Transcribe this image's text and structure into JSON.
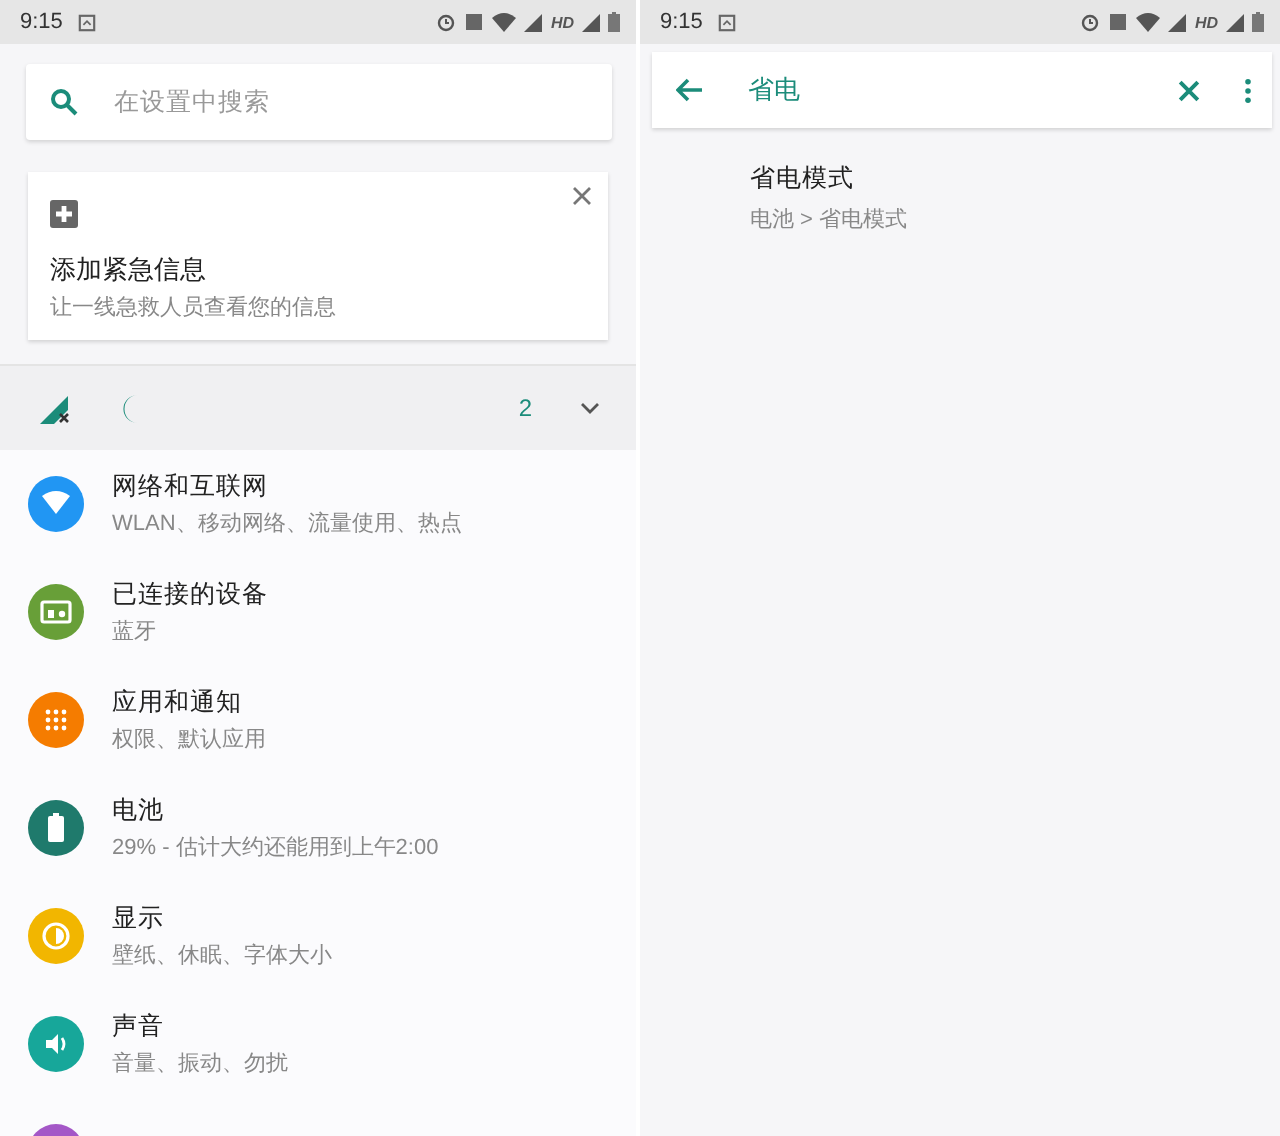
{
  "left_screen": {
    "status_bar": {
      "time": "9:15",
      "network_label": "HD"
    },
    "search": {
      "placeholder": "在设置中搜索"
    },
    "suggestion_card": {
      "title": "添加紧急信息",
      "subtitle": "让一线急救人员查看您的信息"
    },
    "conditions": {
      "count": "2",
      "expanded": false
    },
    "settings": [
      {
        "kind": "network",
        "color": "#2196f3",
        "title": "网络和互联网",
        "subtitle": "WLAN、移动网络、流量使用、热点"
      },
      {
        "kind": "devices",
        "color": "#689f38",
        "title": "已连接的设备",
        "subtitle": "蓝牙"
      },
      {
        "kind": "apps",
        "color": "#f57c00",
        "title": "应用和通知",
        "subtitle": "权限、默认应用"
      },
      {
        "kind": "battery",
        "color": "#1f7a6c",
        "title": "电池",
        "subtitle": "29% - 估计大约还能用到上午2:00"
      },
      {
        "kind": "display",
        "color": "#f2b600",
        "title": "显示",
        "subtitle": "壁纸、休眠、字体大小"
      },
      {
        "kind": "sound",
        "color": "#17a79a",
        "title": "声音",
        "subtitle": "音量、振动、勿扰"
      },
      {
        "kind": "storage",
        "color": "#a457c7"
      }
    ]
  },
  "right_screen": {
    "status_bar": {
      "time": "9:15",
      "network_label": "HD"
    },
    "search": {
      "value": "省电"
    },
    "results": [
      {
        "title": "省电模式",
        "path": "电池 > 省电模式"
      }
    ]
  }
}
